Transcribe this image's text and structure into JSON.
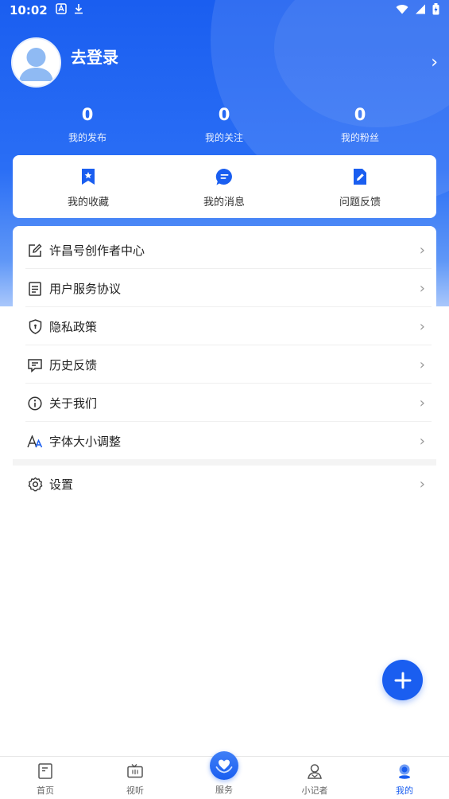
{
  "status_bar": {
    "time": "10:02"
  },
  "profile": {
    "login_text": "去登录",
    "chevron": "›"
  },
  "stats": [
    {
      "value": "0",
      "label": "我的发布"
    },
    {
      "value": "0",
      "label": "我的关注"
    },
    {
      "value": "0",
      "label": "我的粉丝"
    }
  ],
  "quick_actions": [
    {
      "label": "我的收藏",
      "icon": "bookmark-star-icon"
    },
    {
      "label": "我的消息",
      "icon": "chat-bubble-icon"
    },
    {
      "label": "问题反馈",
      "icon": "edit-document-icon"
    }
  ],
  "menu": [
    {
      "label": "许昌号创作者中心",
      "icon": "edit-square-icon"
    },
    {
      "label": "用户服务协议",
      "icon": "document-icon"
    },
    {
      "label": "隐私政策",
      "icon": "shield-icon"
    },
    {
      "label": "历史反馈",
      "icon": "message-icon"
    },
    {
      "label": "关于我们",
      "icon": "info-icon"
    },
    {
      "label": "字体大小调整",
      "icon": "font-size-icon"
    }
  ],
  "settings": {
    "label": "设置",
    "icon": "gear-icon"
  },
  "chevron": "›",
  "bottom_nav": [
    {
      "label": "首页",
      "icon": "home-doc-icon"
    },
    {
      "label": "视听",
      "icon": "tv-icon"
    },
    {
      "label": "服务",
      "icon": "heart-hands-icon"
    },
    {
      "label": "小记者",
      "icon": "reporter-icon"
    },
    {
      "label": "我的",
      "icon": "user-icon"
    }
  ],
  "colors": {
    "accent": "#1a5ef0",
    "text": "#222222",
    "muted": "#999999"
  }
}
